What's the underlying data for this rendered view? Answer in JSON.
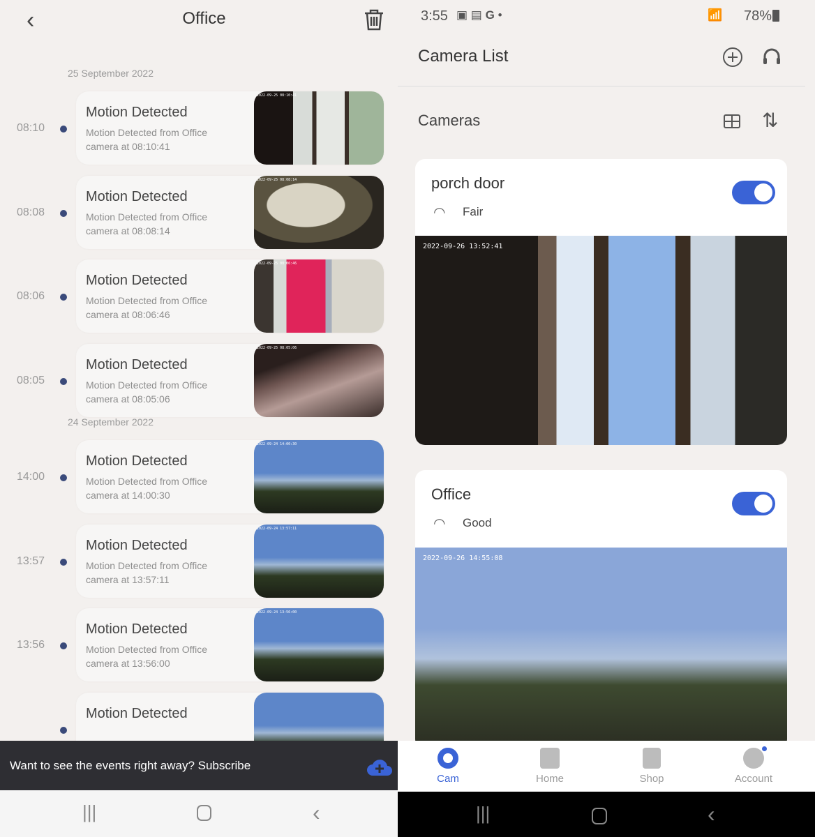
{
  "left": {
    "title": "Office",
    "back_icon": "chevron-left-icon",
    "delete_icon": "trash-icon",
    "groups": [
      {
        "date": "25 September 2022",
        "events": [
          {
            "time": "08:10",
            "title": "Motion Detected",
            "desc": "Motion Detected from Office camera at 08:10:41",
            "thumb_ts": "2022-09-25 08:10:41",
            "scene": "indoor"
          },
          {
            "time": "08:08",
            "title": "Motion Detected",
            "desc": "Motion Detected from Office camera at 08:08:14",
            "thumb_ts": "2022-09-25 08:08:14",
            "scene": "lamp"
          },
          {
            "time": "08:06",
            "title": "Motion Detected",
            "desc": "Motion Detected from Office camera at 08:06:46",
            "thumb_ts": "2022-09-25 08:06:46",
            "scene": "person"
          },
          {
            "time": "08:05",
            "title": "Motion Detected",
            "desc": "Motion Detected from Office camera at 08:05:06",
            "thumb_ts": "2022-09-25 08:05:06",
            "scene": "ceiling"
          }
        ]
      },
      {
        "date": "24 September 2022",
        "events": [
          {
            "time": "14:00",
            "title": "Motion Detected",
            "desc": "Motion Detected from Office camera at 14:00:30",
            "thumb_ts": "2022-09-24 14:00:30",
            "scene": "sky"
          },
          {
            "time": "13:57",
            "title": "Motion Detected",
            "desc": "Motion Detected from Office camera at 13:57:11",
            "thumb_ts": "2022-09-24 13:57:11",
            "scene": "sky"
          },
          {
            "time": "13:56",
            "title": "Motion Detected",
            "desc": "Motion Detected from Office camera at 13:56:00",
            "thumb_ts": "2022-09-24 13:56:00",
            "scene": "sky"
          },
          {
            "time": "",
            "title": "Motion Detected",
            "desc": "",
            "thumb_ts": "",
            "scene": "sky"
          }
        ]
      }
    ],
    "banner": {
      "text": "Want to see the events right away? Subscribe",
      "icon": "cloud-plus-icon",
      "icon_color": "#3a63d6"
    }
  },
  "right": {
    "status": {
      "time": "3:55",
      "battery": "78%",
      "indicators": [
        "gallery-icon",
        "news-icon",
        "google-icon",
        "dot-icon"
      ],
      "right_icons": [
        "wifi-icon",
        "signal-icon",
        "battery-icon"
      ]
    },
    "title": "Camera List",
    "section": "Cameras",
    "cameras": [
      {
        "name": "porch door",
        "signal": "Fair",
        "enabled": true,
        "timestamp": "2022-09-26 13:52:41"
      },
      {
        "name": "Office",
        "signal": "Good",
        "enabled": true,
        "timestamp": "2022-09-26 14:55:08"
      }
    ],
    "nav": [
      {
        "label": "Cam",
        "active": true
      },
      {
        "label": "Home"
      },
      {
        "label": "Shop"
      },
      {
        "label": "Account"
      }
    ],
    "accent": "#3a63d6"
  }
}
